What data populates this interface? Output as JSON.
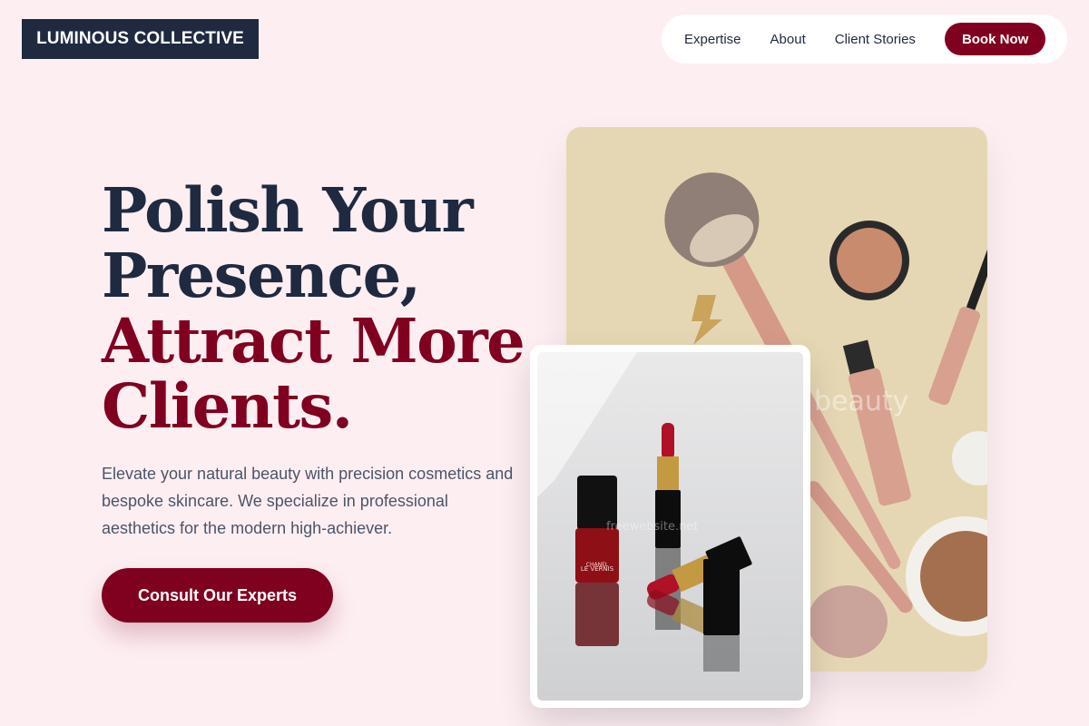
{
  "brand": {
    "name": "LUMINOUS COLLECTIVE"
  },
  "nav": {
    "links": [
      "Expertise",
      "About",
      "Client Stories"
    ],
    "cta": "Book Now"
  },
  "hero": {
    "headline_dark": [
      "Polish Your",
      "Presence,"
    ],
    "headline_accent": [
      "Attract More",
      "Clients."
    ],
    "lead": "Elevate your natural beauty with precision cosmetics and bespoke skincare. We specialize in professional aesthetics for the modern high-achiever.",
    "cta": "Consult Our Experts"
  },
  "images": {
    "main": {
      "subject": "makeup-brushes-flatlay",
      "watermark": "beauty"
    },
    "card": {
      "subject": "chanel-nail-polish-and-lipsticks",
      "watermark": "freewebsite.net"
    },
    "product_labels": [
      "CHANEL",
      "LE VERNIS"
    ]
  },
  "colors": {
    "background": "#fdeef2",
    "navy": "#1f2a40",
    "burgundy": "#800020",
    "main_image_bg": "#e6d7b4"
  }
}
